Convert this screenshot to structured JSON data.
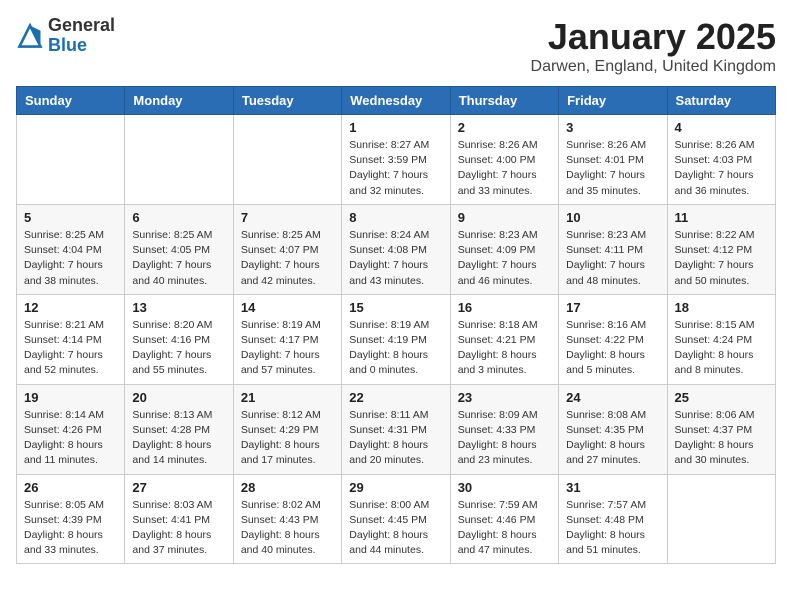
{
  "logo": {
    "general": "General",
    "blue": "Blue"
  },
  "title": {
    "month": "January 2025",
    "location": "Darwen, England, United Kingdom"
  },
  "weekdays": [
    "Sunday",
    "Monday",
    "Tuesday",
    "Wednesday",
    "Thursday",
    "Friday",
    "Saturday"
  ],
  "weeks": [
    [
      {
        "day": "",
        "sunrise": "",
        "sunset": "",
        "daylight": ""
      },
      {
        "day": "",
        "sunrise": "",
        "sunset": "",
        "daylight": ""
      },
      {
        "day": "",
        "sunrise": "",
        "sunset": "",
        "daylight": ""
      },
      {
        "day": "1",
        "sunrise": "Sunrise: 8:27 AM",
        "sunset": "Sunset: 3:59 PM",
        "daylight": "Daylight: 7 hours and 32 minutes."
      },
      {
        "day": "2",
        "sunrise": "Sunrise: 8:26 AM",
        "sunset": "Sunset: 4:00 PM",
        "daylight": "Daylight: 7 hours and 33 minutes."
      },
      {
        "day": "3",
        "sunrise": "Sunrise: 8:26 AM",
        "sunset": "Sunset: 4:01 PM",
        "daylight": "Daylight: 7 hours and 35 minutes."
      },
      {
        "day": "4",
        "sunrise": "Sunrise: 8:26 AM",
        "sunset": "Sunset: 4:03 PM",
        "daylight": "Daylight: 7 hours and 36 minutes."
      }
    ],
    [
      {
        "day": "5",
        "sunrise": "Sunrise: 8:25 AM",
        "sunset": "Sunset: 4:04 PM",
        "daylight": "Daylight: 7 hours and 38 minutes."
      },
      {
        "day": "6",
        "sunrise": "Sunrise: 8:25 AM",
        "sunset": "Sunset: 4:05 PM",
        "daylight": "Daylight: 7 hours and 40 minutes."
      },
      {
        "day": "7",
        "sunrise": "Sunrise: 8:25 AM",
        "sunset": "Sunset: 4:07 PM",
        "daylight": "Daylight: 7 hours and 42 minutes."
      },
      {
        "day": "8",
        "sunrise": "Sunrise: 8:24 AM",
        "sunset": "Sunset: 4:08 PM",
        "daylight": "Daylight: 7 hours and 43 minutes."
      },
      {
        "day": "9",
        "sunrise": "Sunrise: 8:23 AM",
        "sunset": "Sunset: 4:09 PM",
        "daylight": "Daylight: 7 hours and 46 minutes."
      },
      {
        "day": "10",
        "sunrise": "Sunrise: 8:23 AM",
        "sunset": "Sunset: 4:11 PM",
        "daylight": "Daylight: 7 hours and 48 minutes."
      },
      {
        "day": "11",
        "sunrise": "Sunrise: 8:22 AM",
        "sunset": "Sunset: 4:12 PM",
        "daylight": "Daylight: 7 hours and 50 minutes."
      }
    ],
    [
      {
        "day": "12",
        "sunrise": "Sunrise: 8:21 AM",
        "sunset": "Sunset: 4:14 PM",
        "daylight": "Daylight: 7 hours and 52 minutes."
      },
      {
        "day": "13",
        "sunrise": "Sunrise: 8:20 AM",
        "sunset": "Sunset: 4:16 PM",
        "daylight": "Daylight: 7 hours and 55 minutes."
      },
      {
        "day": "14",
        "sunrise": "Sunrise: 8:19 AM",
        "sunset": "Sunset: 4:17 PM",
        "daylight": "Daylight: 7 hours and 57 minutes."
      },
      {
        "day": "15",
        "sunrise": "Sunrise: 8:19 AM",
        "sunset": "Sunset: 4:19 PM",
        "daylight": "Daylight: 8 hours and 0 minutes."
      },
      {
        "day": "16",
        "sunrise": "Sunrise: 8:18 AM",
        "sunset": "Sunset: 4:21 PM",
        "daylight": "Daylight: 8 hours and 3 minutes."
      },
      {
        "day": "17",
        "sunrise": "Sunrise: 8:16 AM",
        "sunset": "Sunset: 4:22 PM",
        "daylight": "Daylight: 8 hours and 5 minutes."
      },
      {
        "day": "18",
        "sunrise": "Sunrise: 8:15 AM",
        "sunset": "Sunset: 4:24 PM",
        "daylight": "Daylight: 8 hours and 8 minutes."
      }
    ],
    [
      {
        "day": "19",
        "sunrise": "Sunrise: 8:14 AM",
        "sunset": "Sunset: 4:26 PM",
        "daylight": "Daylight: 8 hours and 11 minutes."
      },
      {
        "day": "20",
        "sunrise": "Sunrise: 8:13 AM",
        "sunset": "Sunset: 4:28 PM",
        "daylight": "Daylight: 8 hours and 14 minutes."
      },
      {
        "day": "21",
        "sunrise": "Sunrise: 8:12 AM",
        "sunset": "Sunset: 4:29 PM",
        "daylight": "Daylight: 8 hours and 17 minutes."
      },
      {
        "day": "22",
        "sunrise": "Sunrise: 8:11 AM",
        "sunset": "Sunset: 4:31 PM",
        "daylight": "Daylight: 8 hours and 20 minutes."
      },
      {
        "day": "23",
        "sunrise": "Sunrise: 8:09 AM",
        "sunset": "Sunset: 4:33 PM",
        "daylight": "Daylight: 8 hours and 23 minutes."
      },
      {
        "day": "24",
        "sunrise": "Sunrise: 8:08 AM",
        "sunset": "Sunset: 4:35 PM",
        "daylight": "Daylight: 8 hours and 27 minutes."
      },
      {
        "day": "25",
        "sunrise": "Sunrise: 8:06 AM",
        "sunset": "Sunset: 4:37 PM",
        "daylight": "Daylight: 8 hours and 30 minutes."
      }
    ],
    [
      {
        "day": "26",
        "sunrise": "Sunrise: 8:05 AM",
        "sunset": "Sunset: 4:39 PM",
        "daylight": "Daylight: 8 hours and 33 minutes."
      },
      {
        "day": "27",
        "sunrise": "Sunrise: 8:03 AM",
        "sunset": "Sunset: 4:41 PM",
        "daylight": "Daylight: 8 hours and 37 minutes."
      },
      {
        "day": "28",
        "sunrise": "Sunrise: 8:02 AM",
        "sunset": "Sunset: 4:43 PM",
        "daylight": "Daylight: 8 hours and 40 minutes."
      },
      {
        "day": "29",
        "sunrise": "Sunrise: 8:00 AM",
        "sunset": "Sunset: 4:45 PM",
        "daylight": "Daylight: 8 hours and 44 minutes."
      },
      {
        "day": "30",
        "sunrise": "Sunrise: 7:59 AM",
        "sunset": "Sunset: 4:46 PM",
        "daylight": "Daylight: 8 hours and 47 minutes."
      },
      {
        "day": "31",
        "sunrise": "Sunrise: 7:57 AM",
        "sunset": "Sunset: 4:48 PM",
        "daylight": "Daylight: 8 hours and 51 minutes."
      },
      {
        "day": "",
        "sunrise": "",
        "sunset": "",
        "daylight": ""
      }
    ]
  ]
}
